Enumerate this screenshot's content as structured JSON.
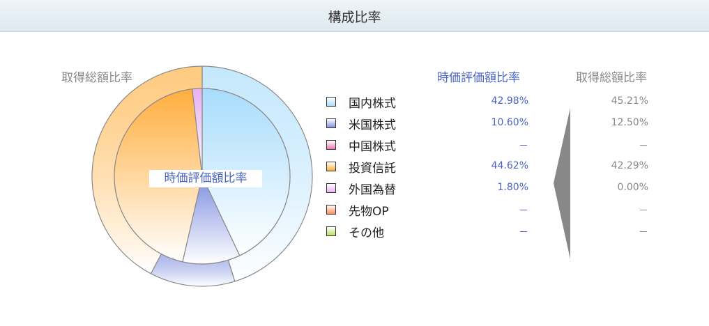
{
  "header": {
    "title": "構成比率"
  },
  "labels": {
    "outer": "取得総額比率",
    "inner": "時価評価額比率",
    "market_head": "時価評価額比率",
    "acq_head": "取得総額比率"
  },
  "chart_data": {
    "type": "pie",
    "title": "",
    "categories": [
      "国内株式",
      "米国株式",
      "中国株式",
      "投資信託",
      "外国為替",
      "先物OP",
      "その他"
    ],
    "series": [
      {
        "name": "時価評価額比率",
        "values": [
          42.98,
          10.6,
          null,
          44.62,
          1.8,
          null,
          null
        ],
        "display": [
          "42.98%",
          "10.60%",
          "－",
          "44.62%",
          "1.80%",
          "－",
          "－"
        ]
      },
      {
        "name": "取得総額比率",
        "values": [
          45.21,
          12.5,
          null,
          42.29,
          0.0,
          null,
          null
        ],
        "display": [
          "45.21%",
          "12.50%",
          "－",
          "42.29%",
          "0.00%",
          "－",
          "－"
        ]
      }
    ],
    "colors": [
      "#a7dcfb",
      "#7f8fe0",
      "#f078b8",
      "#ffae3c",
      "#e8b0f0",
      "#ff8c50",
      "#b8e060"
    ],
    "legend": "right"
  }
}
